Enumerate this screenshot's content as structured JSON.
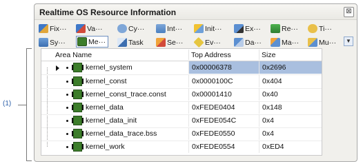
{
  "annotation": {
    "label": "(1)"
  },
  "window": {
    "title": "Realtime OS Resource Information",
    "close_glyph": "⊠"
  },
  "toolbar": {
    "buttons": [
      {
        "label": "Fix···",
        "icon": "fixed-memory-pool-icon"
      },
      {
        "label": "Va···",
        "icon": "variable-memory-pool-icon"
      },
      {
        "label": "Cy···",
        "icon": "cyclic-handler-icon"
      },
      {
        "label": "Int···",
        "icon": "interrupt-handler-icon"
      },
      {
        "label": "Init···",
        "icon": "initialization-routine-icon"
      },
      {
        "label": "Ex···",
        "icon": "exception-handler-icon"
      },
      {
        "label": "Re···",
        "icon": "resource-icon"
      },
      {
        "label": "Ti···",
        "icon": "timer-icon"
      },
      {
        "label": "Sy···",
        "icon": "system-icon"
      },
      {
        "label": "Me···",
        "icon": "memory-area-icon"
      },
      {
        "label": "Task",
        "icon": "task-icon"
      },
      {
        "label": "Se···",
        "icon": "semaphore-icon"
      },
      {
        "label": "Ev···",
        "icon": "event-flag-icon"
      },
      {
        "label": "Da···",
        "icon": "data-queue-icon"
      },
      {
        "label": "Ma···",
        "icon": "mailbox-icon"
      },
      {
        "label": "Mu···",
        "icon": "mutex-icon"
      }
    ],
    "dropdown_glyph": "▼"
  },
  "table": {
    "columns": [
      "Area Name",
      "Top Address",
      "Size"
    ],
    "rows": [
      {
        "name": "kernel_system",
        "address": "0x00006378",
        "size": "0x2696"
      },
      {
        "name": "kernel_const",
        "address": "0x0000100C",
        "size": "0x404"
      },
      {
        "name": "kernel_const_trace.const",
        "address": "0x00001410",
        "size": "0x40"
      },
      {
        "name": "kernel_data",
        "address": "0xFEDE0404",
        "size": "0x148"
      },
      {
        "name": "kernel_data_init",
        "address": "0xFEDE054C",
        "size": "0x4"
      },
      {
        "name": "kernel_data_trace.bss",
        "address": "0xFEDE0550",
        "size": "0x4"
      },
      {
        "name": "kernel_work",
        "address": "0xFEDE0554",
        "size": "0xED4"
      }
    ]
  },
  "colors": {
    "selection": "#a9bfdf",
    "chip_green": "#3c7d2a",
    "label_blue": "#2a5ea8"
  }
}
